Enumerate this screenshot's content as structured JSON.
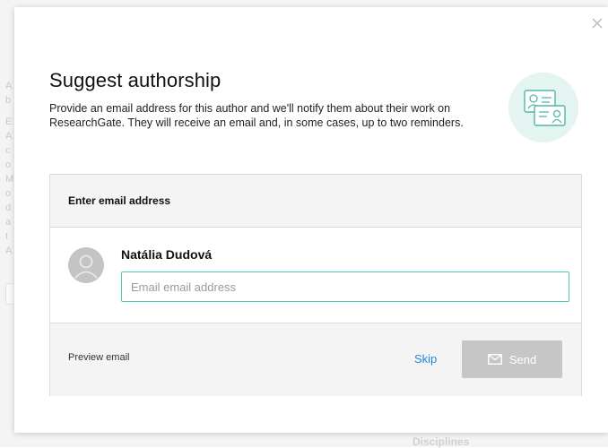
{
  "modal": {
    "title": "Suggest authorship",
    "description": "Provide an email address for this author and we'll notify them about their work on ResearchGate. They will receive an email and, in some cases, up to two reminders.",
    "close_icon": "close-icon",
    "illustration_icon": "contact-cards-icon"
  },
  "panel": {
    "header_label": "Enter email address",
    "author": {
      "name": "Natália Dudová",
      "avatar_icon": "avatar-placeholder-icon",
      "email_value": "",
      "email_placeholder": "Email email address"
    },
    "footer": {
      "preview_label": "Preview email",
      "skip_label": "Skip",
      "send_label": "Send",
      "send_icon": "envelope-icon"
    }
  },
  "background": {
    "section_label": "Disciplines"
  },
  "colors": {
    "accent_teal": "#52c5b5",
    "link_blue": "#1e88e5",
    "send_disabled": "#c6c6c6"
  }
}
